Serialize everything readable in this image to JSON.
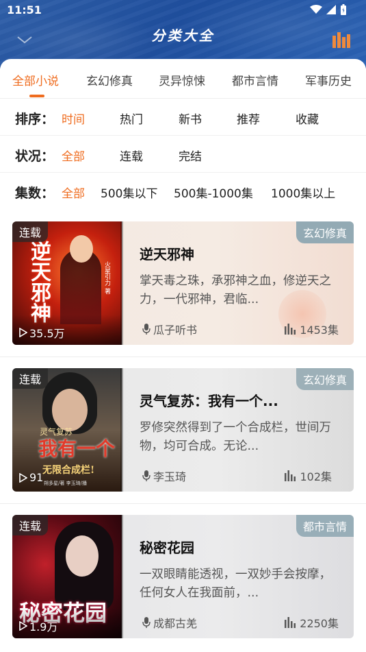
{
  "status": {
    "time": "11:51"
  },
  "header": {
    "title": "分类大全"
  },
  "tabs": [
    {
      "label": "全部小说",
      "active": true
    },
    {
      "label": "玄幻修真"
    },
    {
      "label": "灵异惊悚"
    },
    {
      "label": "都市言情"
    },
    {
      "label": "军事历史"
    }
  ],
  "filters": {
    "sort": {
      "label": "排序：",
      "options": [
        "时间",
        "热门",
        "新书",
        "推荐",
        "收藏"
      ],
      "selected": "时间"
    },
    "status": {
      "label": "状况：",
      "options": [
        "全部",
        "连载",
        "完结"
      ],
      "selected": "全部"
    },
    "episodes": {
      "label": "集数：",
      "options": [
        "全部",
        "500集以下",
        "500集-1000集",
        "1000集以上"
      ],
      "selected": "全部"
    }
  },
  "books": [
    {
      "badge": "连载",
      "plays": "35.5万",
      "title": "逆天邪神",
      "genre": "玄幻修真",
      "desc": "掌天毒之珠，承邪神之血，修逆天之力，一代邪神，君临...",
      "narrator": "瓜子听书",
      "episodes": "1453集",
      "cover_text": "逆天邪神",
      "cover_author": "火星引力 著"
    },
    {
      "badge": "连载",
      "plays": "91",
      "title": "灵气复苏：我有一个...",
      "genre": "玄幻修真",
      "desc": "罗修突然得到了一个合成栏，世间万物，均可合成。无论...",
      "narrator": "李玉琦",
      "episodes": "102集",
      "cover_text": "我有一个",
      "cover_sub": "无限合成栏!",
      "cover_top": "灵气复苏",
      "cover_author": "朔多星/著 李玉琦/播"
    },
    {
      "badge": "连载",
      "plays": "1.9万",
      "title": "秘密花园",
      "genre": "都市言情",
      "desc": "一双眼睛能透视，一双妙手会按摩，任何女人在我面前，...",
      "narrator": "成都古羌",
      "episodes": "2250集",
      "cover_text": "秘密花园"
    }
  ],
  "colors": {
    "accent": "#ef6c1f",
    "header": "#2a5aa8",
    "genre_badge": "#8aa7b8"
  }
}
